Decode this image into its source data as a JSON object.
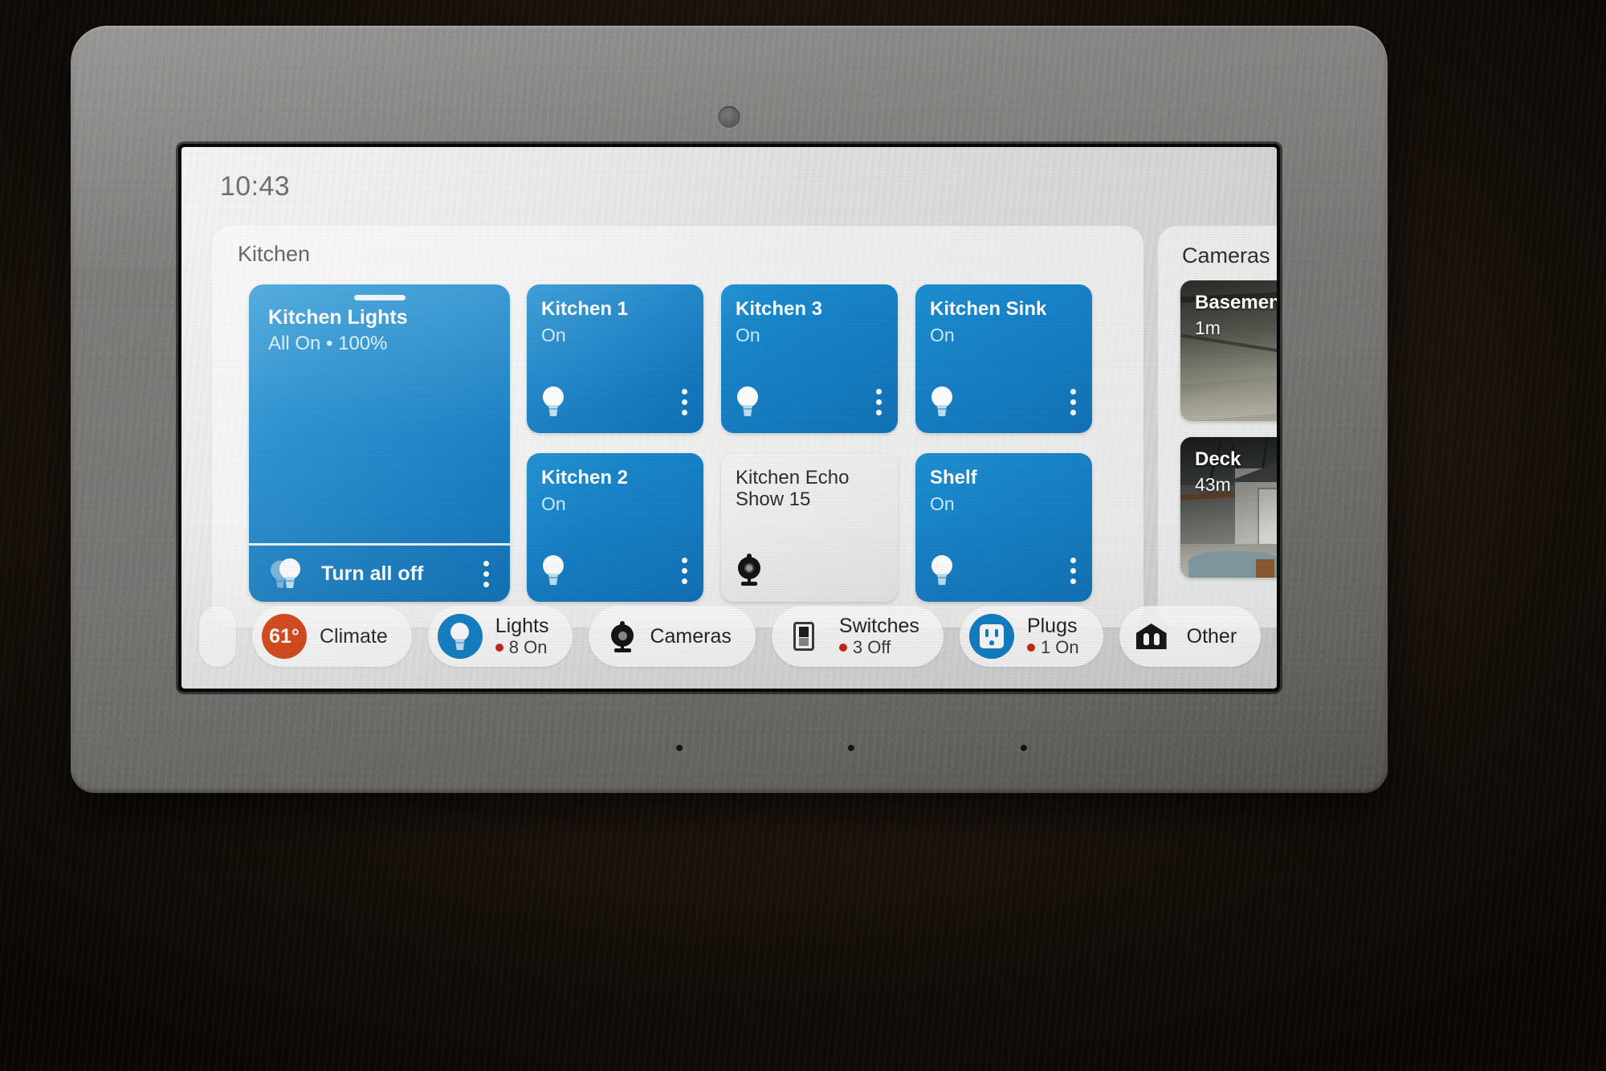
{
  "status_bar": {
    "time": "10:43"
  },
  "kitchen_group": {
    "title": "Kitchen",
    "main_light": {
      "name": "Kitchen Lights",
      "state": "All On • 100%",
      "brightness_percent": 100,
      "turn_all_off_label": "Turn all off",
      "bulb_icon": "double-lightbulb-icon",
      "menu_icon": "overflow-menu-icon",
      "accent_color": "#1580c7"
    },
    "devices": [
      {
        "name": "Kitchen 1",
        "state": "On",
        "type": "light",
        "icon": "lightbulb-icon",
        "on": true
      },
      {
        "name": "Kitchen 3",
        "state": "On",
        "type": "light",
        "icon": "lightbulb-icon",
        "on": true
      },
      {
        "name": "Kitchen Sink",
        "state": "On",
        "type": "light",
        "icon": "lightbulb-icon",
        "on": true
      },
      {
        "name": "Kitchen 2",
        "state": "On",
        "type": "light",
        "icon": "lightbulb-icon",
        "on": true
      },
      {
        "name": "Kitchen Echo Show 15",
        "state": "",
        "type": "echo-show",
        "icon": "echo-show-camera-icon",
        "on": false
      },
      {
        "name": "Shelf",
        "state": "On",
        "type": "light",
        "icon": "lightbulb-icon",
        "on": true
      }
    ]
  },
  "cameras_group": {
    "title": "Cameras",
    "feeds": [
      {
        "name": "Basement",
        "last_seen": "1m"
      },
      {
        "name": "Deck",
        "last_seen": "43m"
      }
    ]
  },
  "chip_bar": {
    "chips": [
      {
        "label": "Climate",
        "sub": "",
        "badge": "61°",
        "icon": "thermometer-badge",
        "style": "orange",
        "has_red_dot": false
      },
      {
        "label": "Lights",
        "sub": "8 On",
        "badge": "",
        "icon": "lightbulb-icon",
        "style": "blue",
        "has_red_dot": true
      },
      {
        "label": "Cameras",
        "sub": "",
        "badge": "",
        "icon": "camera-icon",
        "style": "plain",
        "has_red_dot": false
      },
      {
        "label": "Switches",
        "sub": "3 Off",
        "badge": "",
        "icon": "light-switch-icon",
        "style": "plain",
        "has_red_dot": true
      },
      {
        "label": "Plugs",
        "sub": "1 On",
        "badge": "",
        "icon": "power-outlet-icon",
        "style": "blue",
        "has_red_dot": true
      },
      {
        "label": "Other",
        "sub": "",
        "badge": "",
        "icon": "home-devices-icon",
        "style": "plain",
        "has_red_dot": false
      }
    ]
  },
  "device_hardware": {
    "camera_lens": "front-camera-lens",
    "mic_holes": 3
  },
  "colors": {
    "tile_on": "#1580c7",
    "tile_off": "#eceeec",
    "climate_badge": "#d6400f",
    "status_dot": "#cf2418"
  }
}
